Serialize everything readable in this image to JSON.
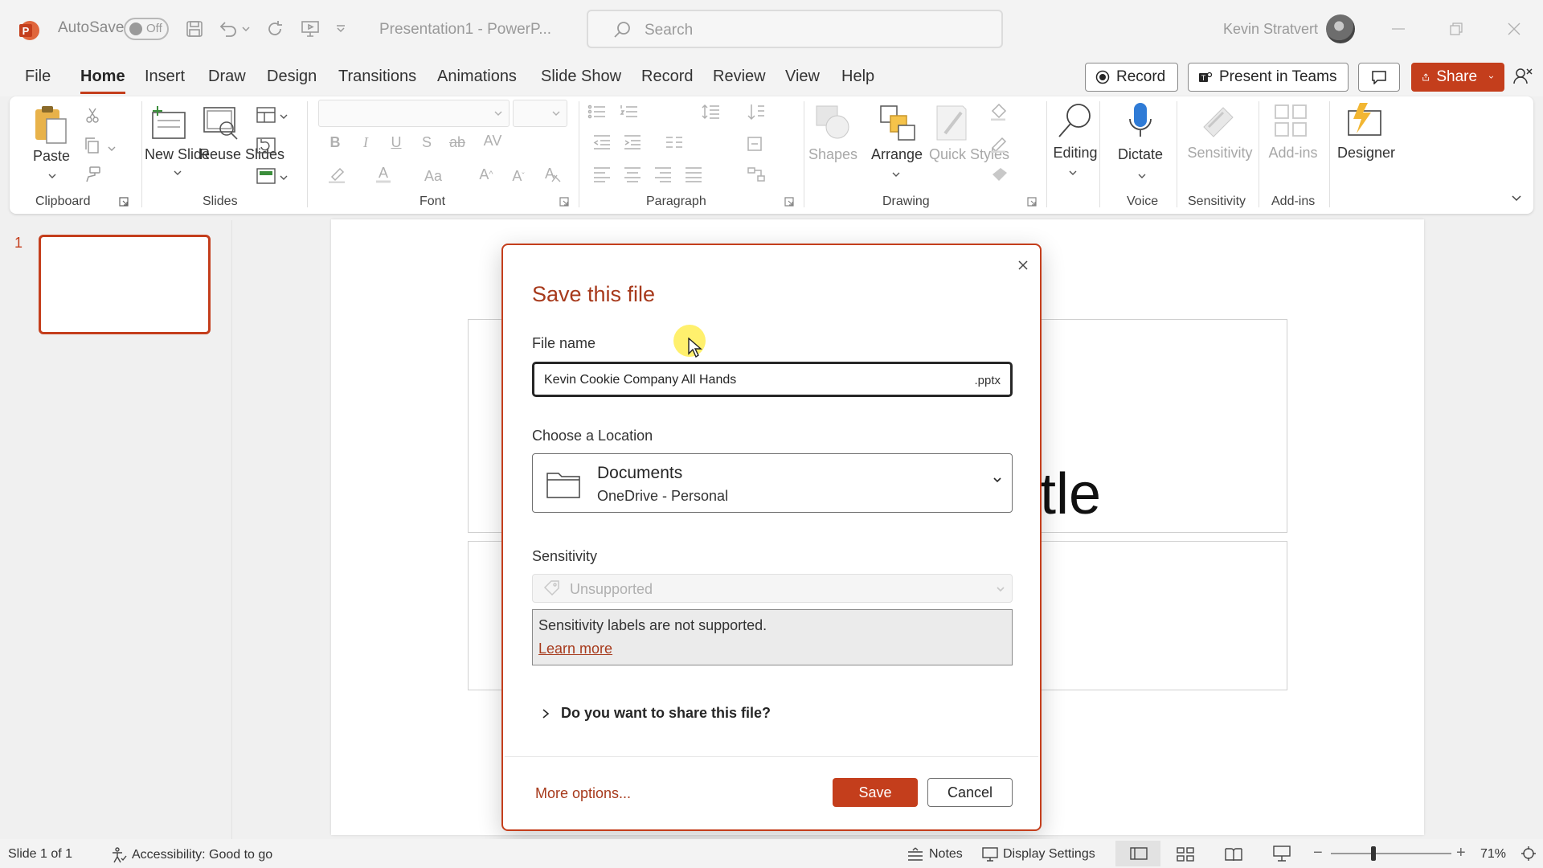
{
  "titlebar": {
    "autosave_label": "AutoSave",
    "autosave_state": "Off",
    "doc_title": "Presentation1  -  PowerP...",
    "search_placeholder": "Search",
    "user_name": "Kevin Stratvert"
  },
  "menu": {
    "tabs": [
      "File",
      "Home",
      "Insert",
      "Draw",
      "Design",
      "Transitions",
      "Animations",
      "Slide Show",
      "Record",
      "Review",
      "View",
      "Help"
    ],
    "active_tab": "Home",
    "record_label": "Record",
    "present_label": "Present in Teams",
    "share_label": "Share"
  },
  "ribbon": {
    "groups": [
      "Clipboard",
      "Slides",
      "Font",
      "Paragraph",
      "Drawing",
      "Voice",
      "Sensitivity",
      "Add-ins"
    ],
    "paste": "Paste",
    "new_slide": "New Slide",
    "reuse_slides": "Reuse Slides",
    "shapes": "Shapes",
    "arrange": "Arrange",
    "quick_styles": "Quick Styles",
    "editing": "Editing",
    "dictate": "Dictate",
    "sensitivity": "Sensitivity",
    "add_ins": "Add-ins",
    "designer": "Designer"
  },
  "thumbnails": {
    "slide_number": "1"
  },
  "slide": {
    "title_fragment": "tle"
  },
  "dialog": {
    "title": "Save this file",
    "file_name_label": "File name",
    "file_name_value": "Kevin Cookie Company All Hands",
    "file_ext": ".pptx",
    "location_label": "Choose a Location",
    "location_name": "Documents",
    "location_sub": "OneDrive - Personal",
    "sensitivity_label": "Sensitivity",
    "sensitivity_value": "Unsupported",
    "sensitivity_message": "Sensitivity labels are not supported.",
    "learn_more": "Learn more",
    "share_question": "Do you want to share this file?",
    "more_options": "More options...",
    "save": "Save",
    "cancel": "Cancel"
  },
  "statusbar": {
    "slide_info": "Slide 1 of 1",
    "accessibility": "Accessibility: Good to go",
    "notes": "Notes",
    "display_settings": "Display Settings",
    "zoom": "71%"
  },
  "colors": {
    "accent": "#c43e1c",
    "dialog_title": "#a73a1c"
  }
}
